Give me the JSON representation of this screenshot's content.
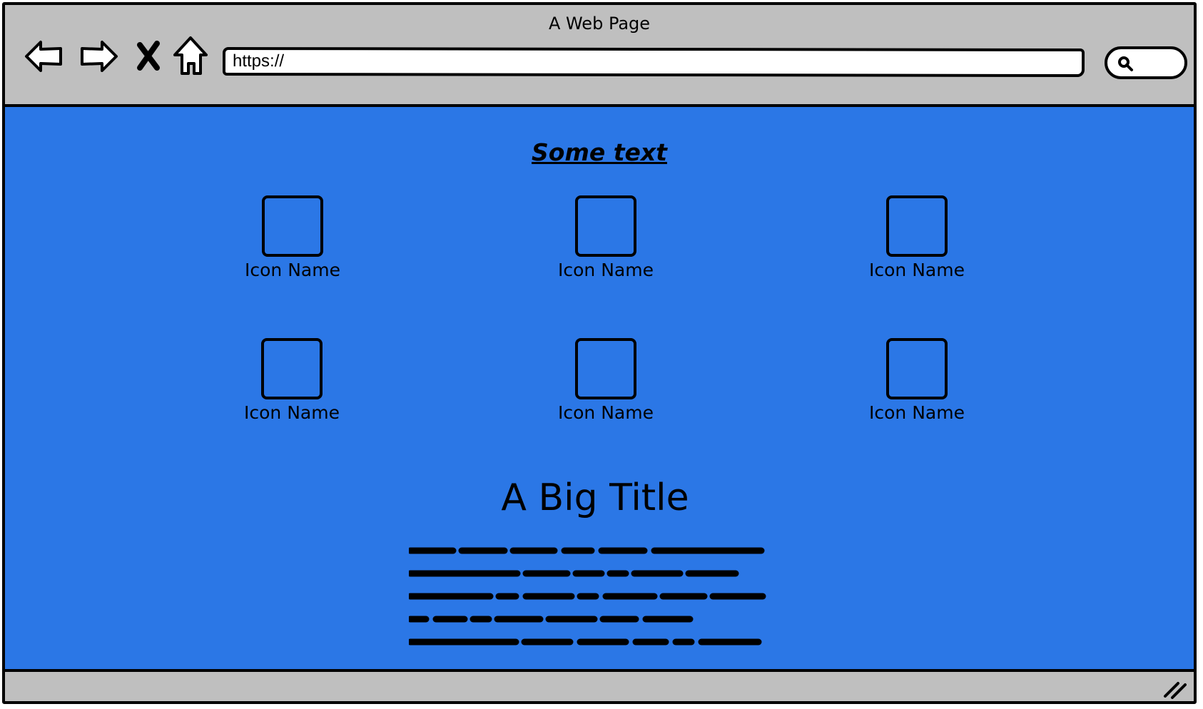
{
  "window": {
    "title": "A Web Page"
  },
  "toolbar": {
    "back_icon": "back-arrow-icon",
    "forward_icon": "forward-arrow-icon",
    "stop_icon": "close-x-icon",
    "home_icon": "home-icon",
    "url_value": "https://",
    "search_icon": "search-icon"
  },
  "page": {
    "link_text": "Some text",
    "icons": [
      {
        "label": "Icon Name"
      },
      {
        "label": "Icon Name"
      },
      {
        "label": "Icon Name"
      },
      {
        "label": "Icon Name"
      },
      {
        "label": "Icon Name"
      },
      {
        "label": "Icon Name"
      }
    ],
    "big_title": "A Big Title",
    "background_color": "#2b77e6"
  }
}
